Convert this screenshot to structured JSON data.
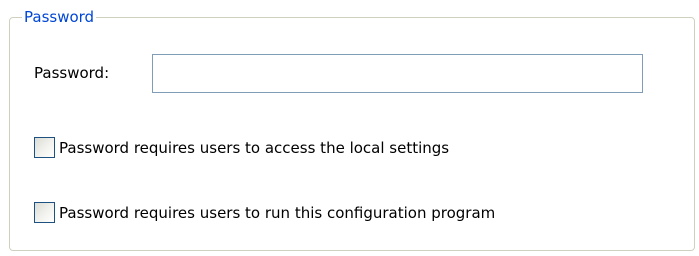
{
  "group": {
    "title": "Password"
  },
  "password_field": {
    "label": "Password:",
    "value": ""
  },
  "options": [
    {
      "label": "Password requires users to access the local settings",
      "checked": false
    },
    {
      "label": "Password requires users to run this configuration program",
      "checked": false
    }
  ]
}
